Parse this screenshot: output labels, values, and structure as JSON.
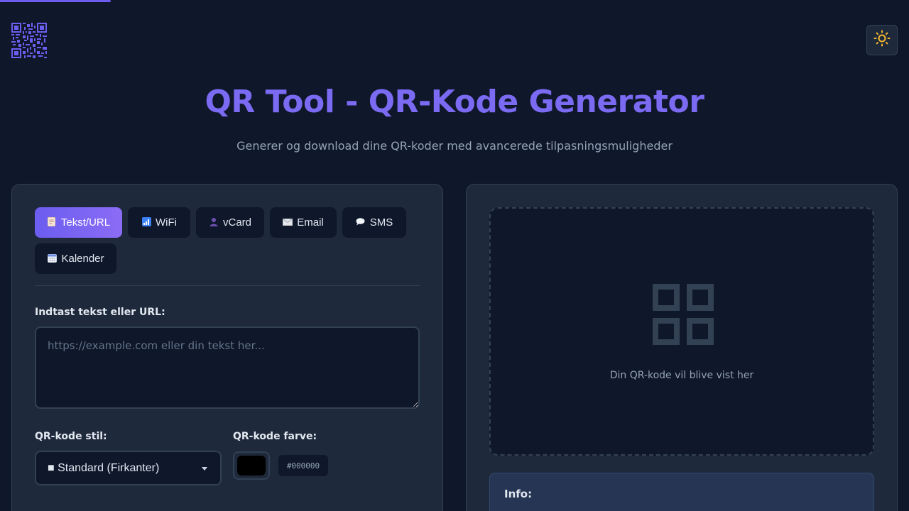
{
  "header": {
    "title": "QR Tool - QR-Kode Generator",
    "subtitle": "Generer og download dine QR-koder med avancerede tilpasningsmuligheder",
    "logo_icon": "qr-code-icon",
    "theme_toggle_icon": "sun-icon"
  },
  "tabs": [
    {
      "label": "Tekst/URL",
      "icon": "document-icon",
      "active": true
    },
    {
      "label": "WiFi",
      "icon": "signal-bars-icon",
      "active": false
    },
    {
      "label": "vCard",
      "icon": "person-icon",
      "active": false
    },
    {
      "label": "Email",
      "icon": "envelope-icon",
      "active": false
    },
    {
      "label": "SMS",
      "icon": "speech-bubble-icon",
      "active": false
    },
    {
      "label": "Kalender",
      "icon": "calendar-icon",
      "active": false
    }
  ],
  "input": {
    "label": "Indtast tekst eller URL:",
    "value": "",
    "placeholder": "https://example.com eller din tekst her..."
  },
  "style": {
    "label": "QR-kode stil:",
    "selected": "■ Standard (Firkanter)"
  },
  "color": {
    "label": "QR-kode farve:",
    "value": "#000000"
  },
  "preview": {
    "placeholder_text": "Din QR-kode vil blive vist her",
    "icon": "qr-grid-icon"
  },
  "info": {
    "title": "Info:"
  },
  "colors": {
    "accent": "#7b6af2",
    "background": "#0f172a",
    "panel": "#1e293b",
    "sun": "#f5b82e"
  }
}
